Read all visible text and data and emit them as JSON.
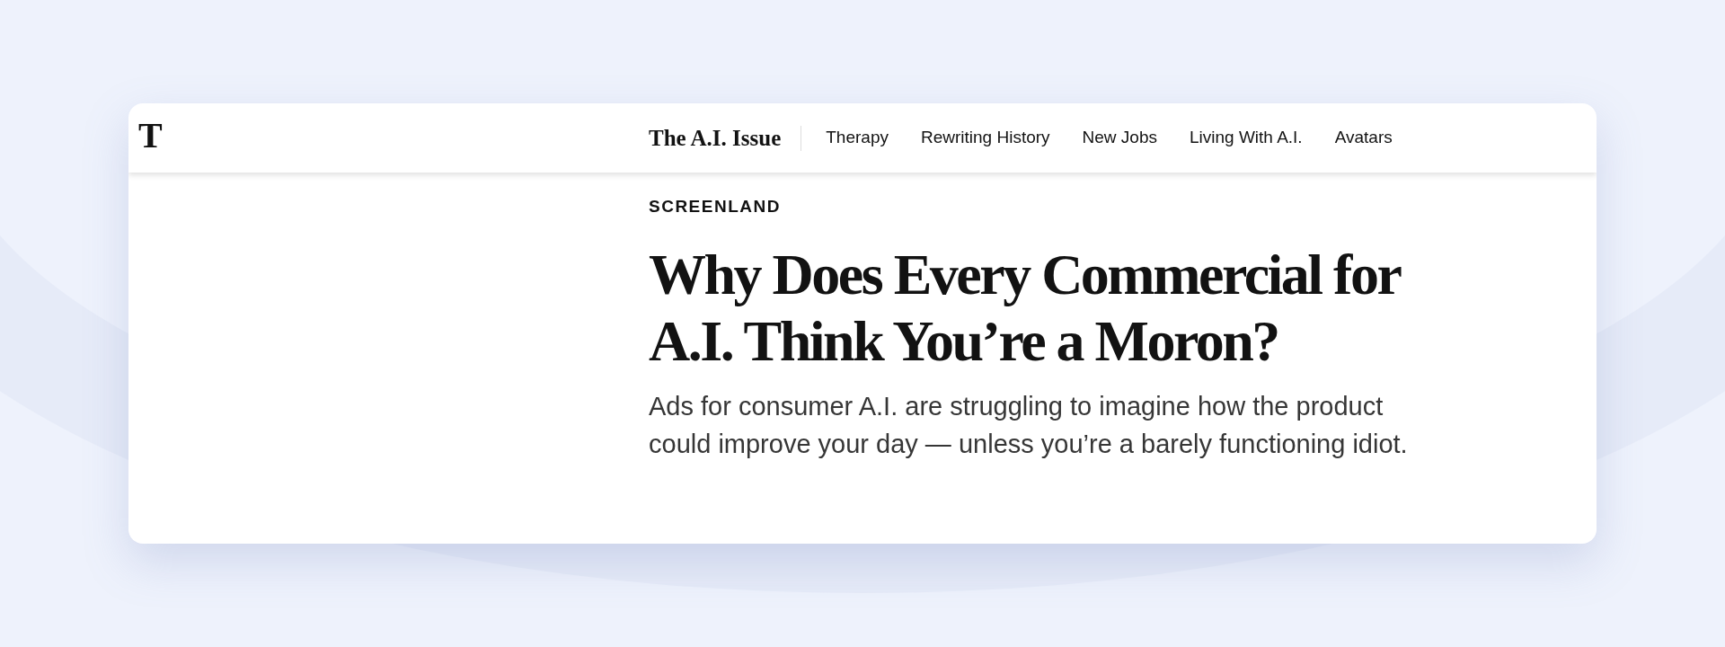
{
  "header": {
    "logo": "T",
    "section_title": "The A.I. Issue",
    "nav": [
      "Therapy",
      "Rewriting History",
      "New Jobs",
      "Living With A.I.",
      "Avatars"
    ]
  },
  "article": {
    "kicker": "SCREENLAND",
    "headline": "Why Does Every Commercial for A.I. Think You’re a Moron?",
    "summary": "Ads for consumer A.I. are struggling to imagine how the product could improve your day — unless you’re a barely functioning idiot."
  }
}
